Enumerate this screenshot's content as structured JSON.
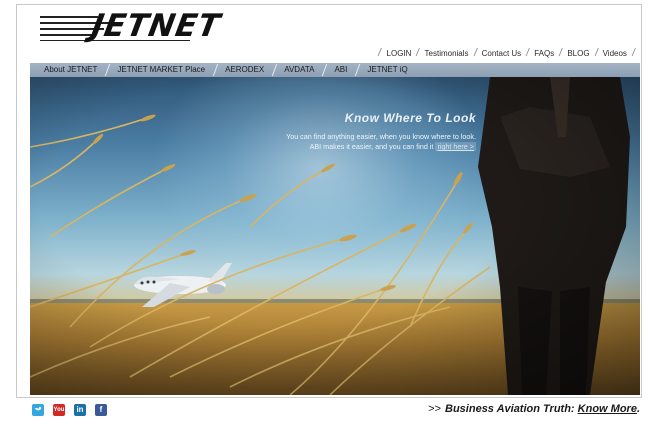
{
  "brand": {
    "logo_text": "JETNET"
  },
  "top_nav": {
    "items": [
      "LOGIN",
      "Testimonials",
      "Contact Us",
      "FAQs",
      "BLOG",
      "Videos"
    ]
  },
  "main_nav": {
    "items": [
      "About JETNET",
      "JETNET MARKET Place",
      "AERODEX",
      "AVDATA",
      "ABI",
      "JETNET iQ"
    ]
  },
  "hero": {
    "headline": "Know Where To Look",
    "line1": "You can find anything easier, when you know where to look.",
    "line2_prefix": "ABI makes it easier, and you can find it ",
    "link_text": "right here >"
  },
  "social": {
    "icons": [
      "twitter-icon",
      "youtube-icon",
      "linkedin-icon",
      "facebook-icon"
    ],
    "youtube_label": "You",
    "linkedin_label": "in",
    "facebook_label": "f"
  },
  "footer": {
    "prefix": ">>",
    "tagline": "Business Aviation Truth: ",
    "link_text": "Know More",
    "suffix": "."
  },
  "colors": {
    "nav_bar": "#9aabbe",
    "twitter": "#35a7e0",
    "youtube": "#cf2a27",
    "linkedin": "#1a6fa9",
    "facebook": "#3b5998"
  }
}
